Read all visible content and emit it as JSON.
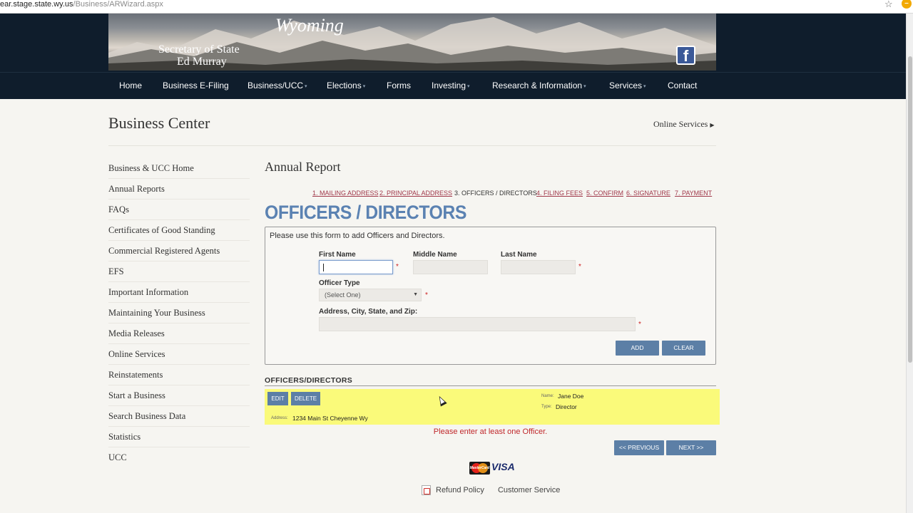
{
  "browser": {
    "url_host": "ear.stage.state.wy.us",
    "url_path": "/Business/ARWizard.aspx",
    "bookmark_icon": "star-icon",
    "extension_icon": "extension-icon"
  },
  "header": {
    "logo_script": "Wyoming",
    "office_line1": "Secretary of State",
    "office_line2": "Ed Murray",
    "social_icon": "facebook-icon",
    "social_glyph": "f"
  },
  "nav": {
    "items": [
      {
        "label": "Home",
        "dropdown": ""
      },
      {
        "label": "Business E-Filing",
        "dropdown": ""
      },
      {
        "label": "Business/UCC",
        "dropdown": "▾"
      },
      {
        "label": "Elections",
        "dropdown": "▾"
      },
      {
        "label": "Forms",
        "dropdown": ""
      },
      {
        "label": "Investing",
        "dropdown": "▾"
      },
      {
        "label": "Research & Information",
        "dropdown": "▾"
      },
      {
        "label": "Services",
        "dropdown": "▾"
      },
      {
        "label": "Contact",
        "dropdown": ""
      }
    ]
  },
  "page": {
    "title": "Business Center",
    "online_services": "Online Services"
  },
  "sidebar": {
    "items": [
      "Business & UCC Home",
      "Annual Reports",
      "FAQs",
      "Certificates of Good Standing",
      "Commercial Registered Agents",
      "EFS",
      "Important Information",
      "Maintaining Your Business",
      "Media Releases",
      "Online Services",
      "Reinstatements",
      "Start a Business",
      "Search Business Data",
      "Statistics",
      "UCC"
    ]
  },
  "main": {
    "section_title": "Annual Report",
    "steps": [
      "1. MAILING ADDRESS",
      "2. PRINCIPAL ADDRESS",
      "3. OFFICERS / DIRECTORS",
      "4. FILING FEES",
      "5. CONFIRM",
      "6. SIGNATURE",
      "7. PAYMENT"
    ],
    "current_step": 3,
    "heading": "OFFICERS / DIRECTORS",
    "form": {
      "intro": "Please use this form to add Officers and Directors.",
      "first_name_label": "First Name",
      "first_name_value": "",
      "middle_name_label": "Middle Name",
      "middle_name_value": "",
      "last_name_label": "Last Name",
      "last_name_value": "",
      "officer_type_label": "Officer Type",
      "officer_type_value": "(Select One)",
      "address_label": "Address, City, State, and Zip:",
      "address_value": "",
      "required_mark": "*",
      "add_button": "ADD",
      "clear_button": "CLEAR"
    },
    "officers": {
      "title": "OFFICERS/DIRECTORS",
      "edit_button": "EDIT",
      "delete_button": "DELETE",
      "rows": [
        {
          "name_label": "Name:",
          "name": "Jane Doe",
          "type_label": "Type:",
          "type": "Director",
          "address_label": "Address:",
          "address": "1234 Main St Cheyenne Wy"
        }
      ]
    },
    "error": "Please enter at least one Officer.",
    "previous_button": "<< PREVIOUS",
    "next_button": "NEXT >>"
  },
  "footer": {
    "mastercard_text": "MasterCard",
    "visa_text": "VISA",
    "refund_policy": "Refund Policy",
    "customer_service": "Customer Service",
    "pdf_icon": "pdf-icon"
  },
  "colors": {
    "header_bg": "#0f1d2c",
    "accent_blue": "#5b82b2",
    "button_blue": "#5c7fa6",
    "step_link": "#a0384a",
    "error_red": "#c0282c",
    "row_highlight": "#fafa7a"
  }
}
